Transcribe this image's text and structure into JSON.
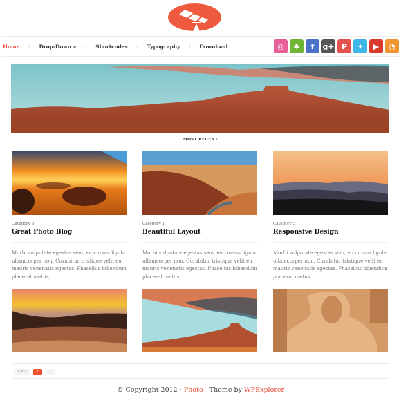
{
  "site": {
    "logo_alt": "Photo theme logo",
    "brand_color": "#ef5a3f"
  },
  "nav": {
    "items": [
      {
        "label": "Home",
        "active": true
      },
      {
        "label": "Drop-Down »",
        "active": false
      },
      {
        "label": "Shortcodes",
        "active": false
      },
      {
        "label": "Typography",
        "active": false
      },
      {
        "label": "Download",
        "active": false
      }
    ],
    "separator": "/"
  },
  "social": [
    {
      "name": "dribbble",
      "glyph": "◎",
      "color": "#e8609a"
    },
    {
      "name": "evernote",
      "glyph": "♣",
      "color": "#6fb536"
    },
    {
      "name": "facebook",
      "glyph": "f",
      "color": "#4a73c8"
    },
    {
      "name": "google-plus",
      "glyph": "g+",
      "color": "#555555"
    },
    {
      "name": "pinterest",
      "glyph": "P",
      "color": "#e3524d"
    },
    {
      "name": "twitter",
      "glyph": "✦",
      "color": "#3fb6e8"
    },
    {
      "name": "youtube",
      "glyph": "▶",
      "color": "#d93a2b"
    },
    {
      "name": "rss",
      "glyph": "◔",
      "color": "#f19530"
    }
  ],
  "section_title": "MOST RECENT",
  "posts": [
    {
      "category": "Category 5",
      "title": "Great Photo Blog",
      "excerpt": "Morbi vulputate egestas sem, eu cursus ligula ullamcorper non. Curabitur tristique velit eu mauris venenatis egestas. Phasellus bibendum placerat metus,…"
    },
    {
      "category": "Category 1",
      "title": "Beautiful Layout",
      "excerpt": "Morbi vulputate egestas sem, eu cursus ligula ullamcorper non. Curabitur tristique velit eu mauris venenatis egestas. Phasellus bibendum placerat metus,…"
    },
    {
      "category": "Category 5",
      "title": "Responsive Design",
      "excerpt": "Morbi vulputate egestas sem, eu cursus ligula ullamcorper non. Curabitur tristique velit eu mauris venenatis egestas. Phasellus bibendum placerat metus,…"
    }
  ],
  "pagination": {
    "summary": "1 of 2",
    "current": "1",
    "next": "2"
  },
  "footer": {
    "prefix": "© Copyright 2012 · ",
    "site_link": "Photo",
    "middle": " - Theme by ",
    "author_link": "WPExplorer"
  }
}
